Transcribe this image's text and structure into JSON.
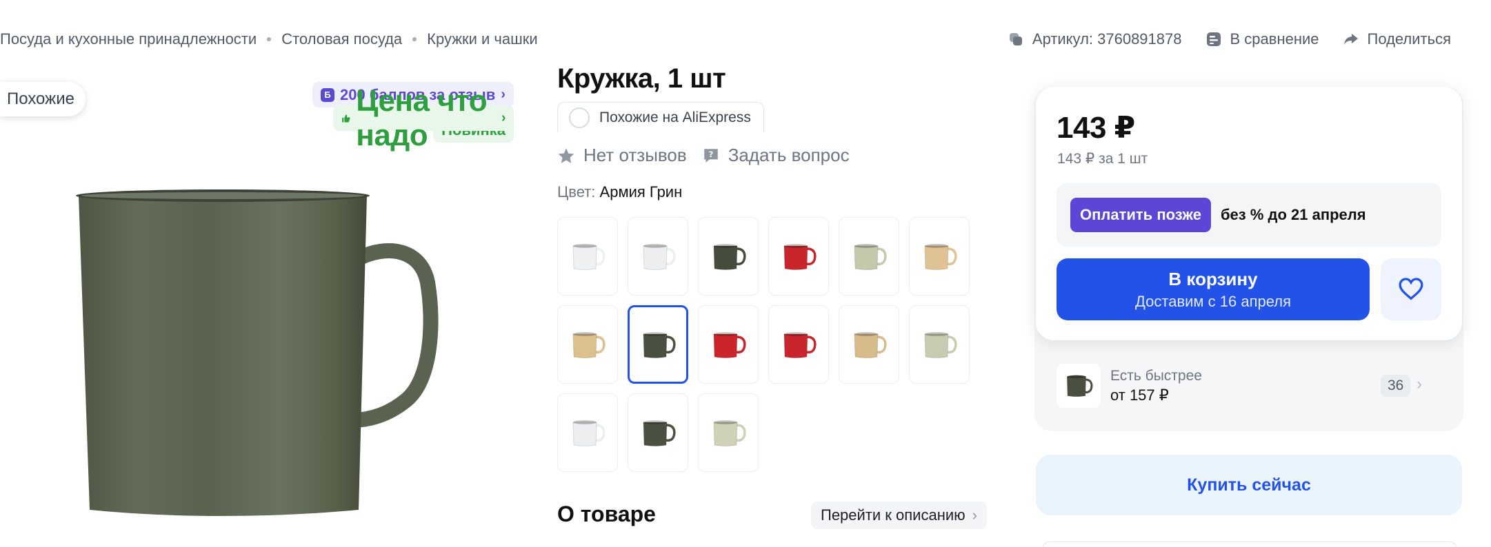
{
  "breadcrumb": [
    "Посуда и кухонные принадлежности",
    "Столовая посуда",
    "Кружки и чашки"
  ],
  "top_actions": {
    "article": "Артикул: 3760891878",
    "compare": "В сравнение",
    "share": "Поделиться"
  },
  "gallery": {
    "similar_label": "Похожие",
    "badges": {
      "points": "200 баллов за отзыв",
      "points_icon_letter": "Б",
      "price": "Цена что надо",
      "new": "Новинка"
    },
    "main_mug_color": "#5b6450"
  },
  "product": {
    "title": "Кружка, 1 шт",
    "aliexpress": "Похожие на AliExpress",
    "reviews": "Нет отзывов",
    "ask": "Задать вопрос",
    "color_prefix": "Цвет:",
    "color_value": "Армия Грин",
    "swatches": [
      {
        "color": "#eef0f1",
        "selected": false
      },
      {
        "color": "#eceeef",
        "selected": false
      },
      {
        "color": "#464c3d",
        "selected": false
      },
      {
        "color": "#c8262a",
        "selected": false
      },
      {
        "color": "#c4c9ac",
        "selected": false
      },
      {
        "color": "#dfc394",
        "selected": false
      },
      {
        "color": "#dcc08e",
        "selected": false
      },
      {
        "color": "#4a5040",
        "selected": true
      },
      {
        "color": "#c9252a",
        "selected": false
      },
      {
        "color": "#c8262c",
        "selected": false
      },
      {
        "color": "#d8bb8a",
        "selected": false
      },
      {
        "color": "#c7ccb1",
        "selected": false
      },
      {
        "color": "#eceeef",
        "selected": false
      },
      {
        "color": "#4b5141",
        "selected": false
      },
      {
        "color": "#cfd1b6",
        "selected": false
      }
    ],
    "about_title": "О товаре",
    "to_description": "Перейти к описанию"
  },
  "buy": {
    "price": "143 ₽",
    "price_per_unit": "143 ₽ за 1 шт",
    "pay_later_button": "Оплатить позже",
    "pay_later_text": "без % до 21 апреля",
    "cart_label": "В корзину",
    "cart_delivery": "Доставим с 16 апреля",
    "faster_label": "Есть быстрее",
    "faster_price": "от 157 ₽",
    "faster_count": "36",
    "buy_now": "Купить сейчас"
  },
  "colors": {
    "accent": "#2352e8",
    "pay_later": "#5b46d6",
    "green_badge": "#2e9f3e",
    "points_badge": "#5a4ad1"
  }
}
